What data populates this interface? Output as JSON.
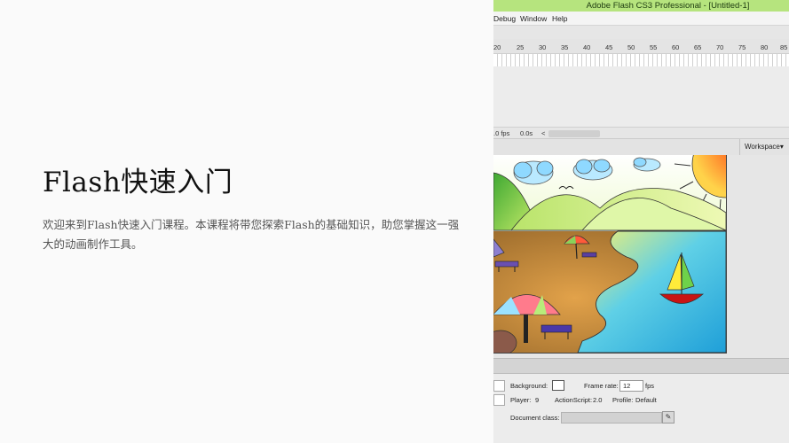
{
  "slide": {
    "title": "Flash快速入门",
    "body": "欢迎来到Flash快速入门课程。本课程将带您探索Flash的基础知识，助您掌握这一强大的动画制作工具。"
  },
  "window": {
    "title": "Adobe Flash CS3 Professional - [Untitled-1]"
  },
  "menu": {
    "items": [
      "Debug",
      "Window",
      "Help"
    ]
  },
  "timeline": {
    "ruler_ticks": [
      "20",
      "25",
      "30",
      "35",
      "40",
      "45",
      "50",
      "55",
      "60",
      "65",
      "70",
      "75",
      "80",
      "85"
    ],
    "fps": ".0 fps",
    "time": "0.0s",
    "scroll_arrow": "<"
  },
  "workspace": {
    "label": "Workspace▾"
  },
  "properties": {
    "background_label": "Background:",
    "frame_rate_label": "Frame rate:",
    "frame_rate_value": "12",
    "fps_unit": "fps",
    "player_label": "Player:",
    "player_value": "9",
    "actionscript_label": "ActionScript:",
    "actionscript_value": "2.0",
    "profile_label": "Profile:",
    "profile_value": "Default",
    "document_class_label": "Document class:",
    "pencil": "✎"
  },
  "colors": {
    "titlebar": "#b6e47e",
    "sand": "#b8843f",
    "water": "#3fb6dc",
    "sky": "#ffffff",
    "hills": "#9bd04a",
    "sun": "#f25c1e"
  }
}
